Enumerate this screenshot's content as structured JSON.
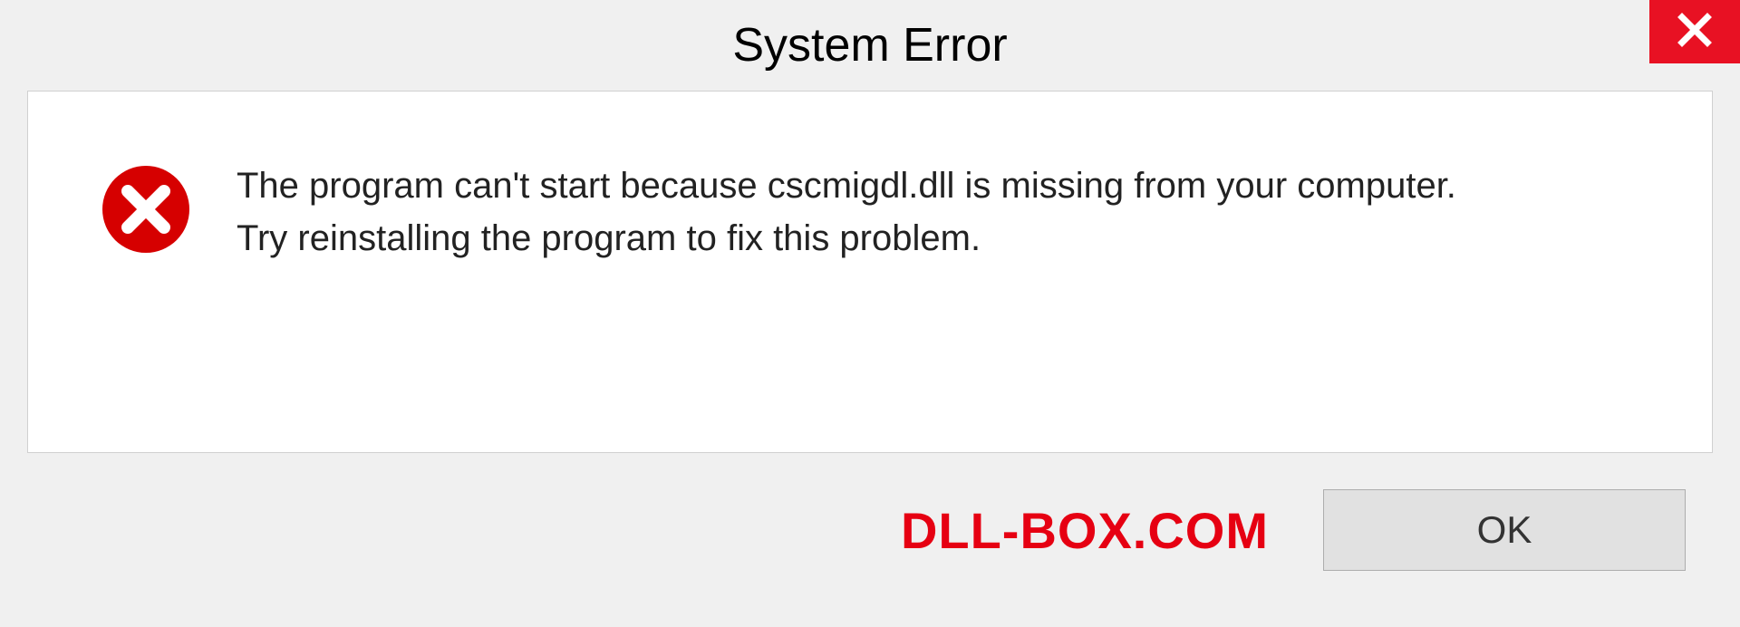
{
  "titlebar": {
    "title": "System Error",
    "close_icon": "close-icon"
  },
  "dialog": {
    "error_icon": "error-circle-x-icon",
    "message_line1": "The program can't start because cscmigdl.dll is missing from your computer.",
    "message_line2": "Try reinstalling the program to fix this problem."
  },
  "footer": {
    "watermark": "DLL-BOX.COM",
    "ok_label": "OK"
  },
  "colors": {
    "close_bg": "#e81123",
    "error_icon": "#d60000",
    "watermark": "#e60012",
    "panel_bg": "#ffffff",
    "body_bg": "#f0f0f0"
  }
}
